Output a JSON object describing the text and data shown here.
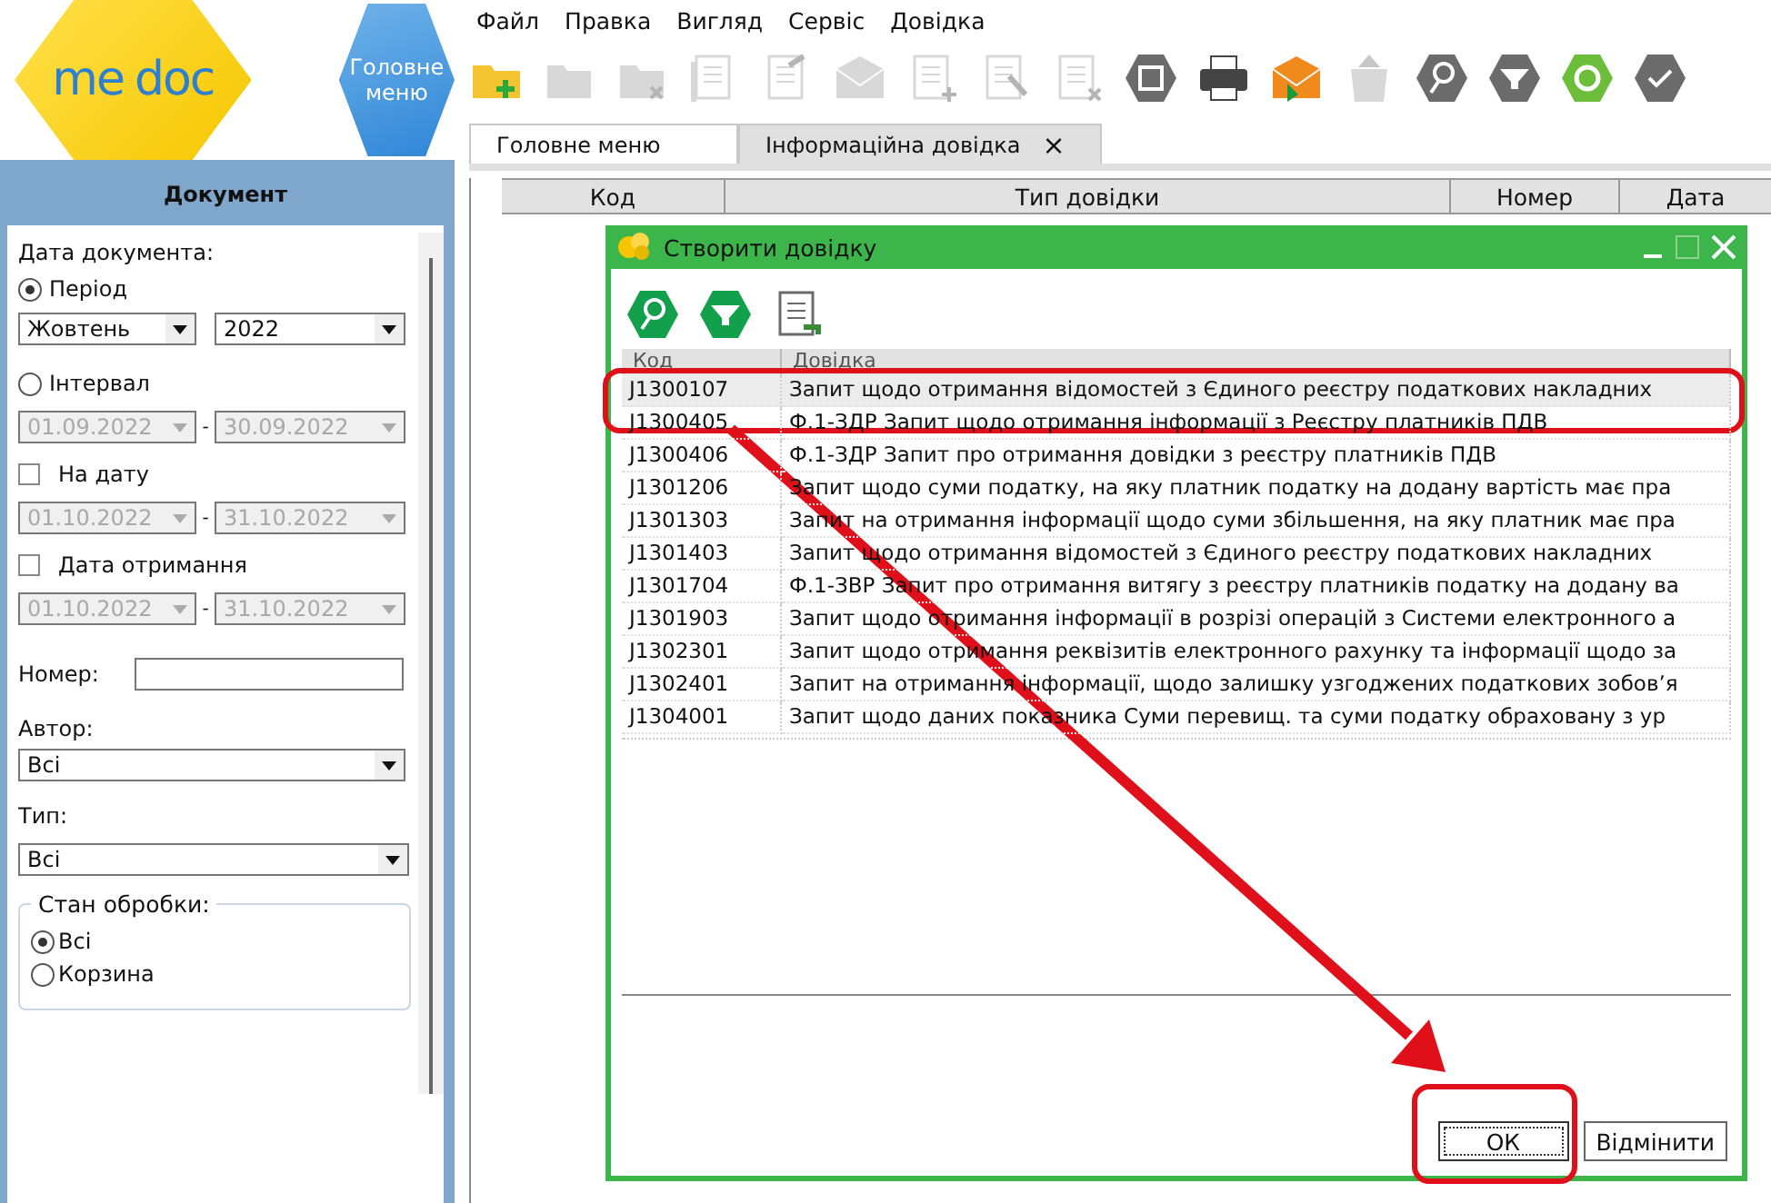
{
  "logo": {
    "part_1": "me",
    "part_2": "doc"
  },
  "home_button": {
    "label": "Головне меню"
  },
  "menu": [
    "Файл",
    "Правка",
    "Вигляд",
    "Сервіс",
    "Довідка"
  ],
  "toolbar": [
    {
      "kind": "folder-plus",
      "disabled": false
    },
    {
      "kind": "folder",
      "disabled": true
    },
    {
      "kind": "folder-x",
      "disabled": true
    },
    {
      "kind": "documents",
      "disabled": true
    },
    {
      "kind": "document-edit",
      "disabled": true
    },
    {
      "kind": "envelope-arrow",
      "disabled": true
    },
    {
      "kind": "document-plus",
      "disabled": true
    },
    {
      "kind": "document-pencil",
      "disabled": true
    },
    {
      "kind": "document-x",
      "disabled": true
    },
    {
      "kind": "hex-save",
      "disabled": false
    },
    {
      "kind": "printer",
      "disabled": false
    },
    {
      "kind": "envelope",
      "disabled": false
    },
    {
      "kind": "trash",
      "disabled": true
    },
    {
      "kind": "hex-search",
      "disabled": false
    },
    {
      "kind": "hex-filter",
      "disabled": false
    },
    {
      "kind": "hex-refresh",
      "disabled": false
    },
    {
      "kind": "hex-check",
      "disabled": false
    }
  ],
  "tabs": [
    {
      "label": "Головне меню",
      "selected": false
    },
    {
      "label": "Інформаційна довідка",
      "selected": true,
      "close": "×"
    }
  ],
  "sidebar": {
    "title": "Документ",
    "date_label": "Дата документа:",
    "period": {
      "label": "Період",
      "selected": true,
      "month": "Жовтень",
      "year": "2022"
    },
    "interval": {
      "label": "Інтервал",
      "selected": false,
      "from": "01.09.2022",
      "separator": "-",
      "to": "30.09.2022"
    },
    "on_date": {
      "label": "На дату",
      "checked": false,
      "from": "01.10.2022",
      "separator": "-",
      "to": "31.10.2022"
    },
    "received": {
      "label": "Дата отримання",
      "checked": false,
      "from": "01.10.2022",
      "separator": "-",
      "to": "31.10.2022"
    },
    "number": {
      "label": "Номер:"
    },
    "author": {
      "label": "Автор:",
      "value": "Всі"
    },
    "type": {
      "label": "Тип:",
      "value": "Всі"
    },
    "status": {
      "label": "Стан обробки:",
      "options": [
        {
          "label": "Всі",
          "selected": true
        },
        {
          "label": "Корзина",
          "selected": false
        }
      ]
    }
  },
  "table": {
    "columns": [
      "Код",
      "Тип довідки",
      "Номер",
      "Дата"
    ]
  },
  "dialog": {
    "title": "Створити довідку",
    "toolbar": [
      {
        "kind": "hex-search"
      },
      {
        "kind": "hex-filter"
      },
      {
        "kind": "document-arrow"
      }
    ],
    "columns": [
      "Код",
      "Довідка"
    ],
    "rows": [
      {
        "code": "J1300107",
        "name": "Запит щодо отримання відомостей з Єдиного реєстру податкових накладних",
        "selected": true
      },
      {
        "code": "J1300405",
        "name": "Ф.1-ЗДР Запит щодо отримання інформації з Реєстру платників ПДВ",
        "selected": false
      },
      {
        "code": "J1300406",
        "name": "Ф.1-ЗДР Запит про отримання довідки з реєстру платників ПДВ",
        "selected": false
      },
      {
        "code": "J1301206",
        "name": "Запит щодо суми податку, на яку платник податку на додану вартість має пра",
        "selected": false
      },
      {
        "code": "J1301303",
        "name": "Запит на отримання інформації щодо суми збільшення, на яку платник має пра",
        "selected": false
      },
      {
        "code": "J1301403",
        "name": "Запит щодо отримання відомостей з Єдиного реєстру податкових накладних",
        "selected": false
      },
      {
        "code": "J1301704",
        "name": "Ф.1-ЗВР Запит про отримання витягу з реєстру платників податку на додану ва",
        "selected": false
      },
      {
        "code": "J1301903",
        "name": "Запит щодо отримання інформації в розрізі операцій з Системи електронного а",
        "selected": false
      },
      {
        "code": "J1302301",
        "name": "Запит щодо отримання реквізитів електронного рахунку та інформації щодо за",
        "selected": false
      },
      {
        "code": "J1302401",
        "name": "Запит на отримання інформації, щодо залишку узгоджених податкових зобов’я",
        "selected": false
      },
      {
        "code": "J1304001",
        "name": "Запит щодо даних показника Суми перевищ. та суми податку обраховану з ур",
        "selected": false
      }
    ],
    "buttons": [
      {
        "label": "ОК",
        "focused": true
      },
      {
        "label": "Відмінити",
        "focused": false
      }
    ]
  }
}
